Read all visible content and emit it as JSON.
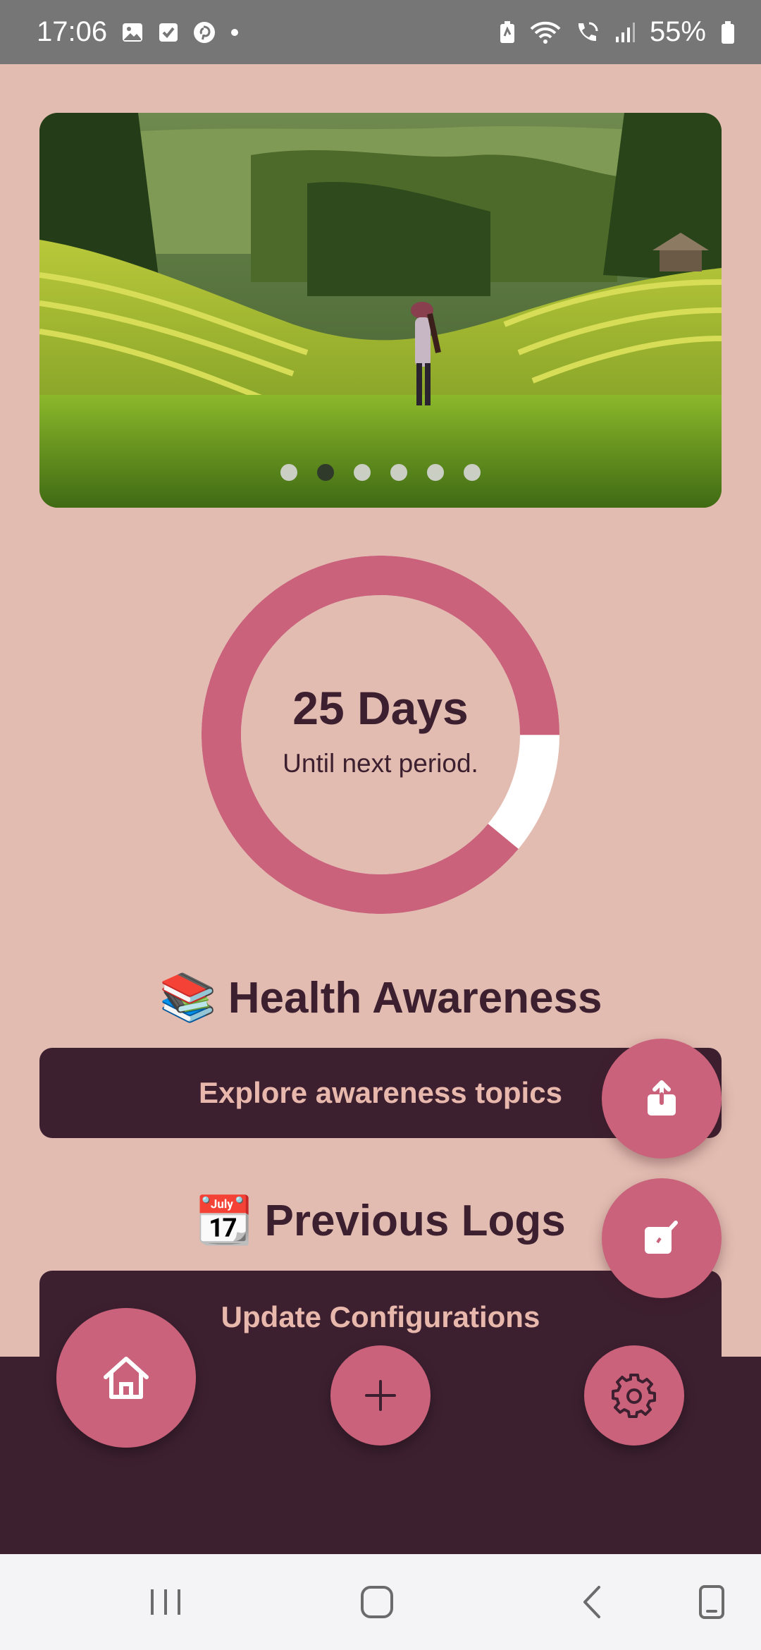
{
  "status_bar": {
    "time": "17:06",
    "battery": "55%",
    "left_icons": [
      "gallery-icon",
      "checkbox-icon",
      "pinterest-icon",
      "dot-icon"
    ],
    "right_icons": [
      "battery-saver-icon",
      "wifi-icon",
      "wifi-calling-icon",
      "signal-icon",
      "battery-icon"
    ]
  },
  "banner": {
    "slides": 6,
    "active_slide": 2
  },
  "cycle": {
    "days_label": "25 Days",
    "caption": "Until next period.",
    "progress_fraction": 0.89,
    "ring_color": "#c9627a",
    "remaining_color": "#ffffff"
  },
  "awareness": {
    "emoji": "📚",
    "heading": "Health Awareness",
    "button_label": "Explore awareness topics"
  },
  "logs": {
    "emoji": "📆",
    "heading": "Previous Logs",
    "button_label": "Update Configurations"
  },
  "fabs": {
    "share_icon": "share-icon",
    "edit_icon": "edit-icon"
  },
  "bottom_nav": {
    "items": [
      "home-icon",
      "plus-icon",
      "gear-icon"
    ]
  },
  "colors": {
    "background": "#e3bcb1",
    "primary": "#3d2030",
    "accent": "#c9627a",
    "button_text": "#e9b8ac"
  }
}
